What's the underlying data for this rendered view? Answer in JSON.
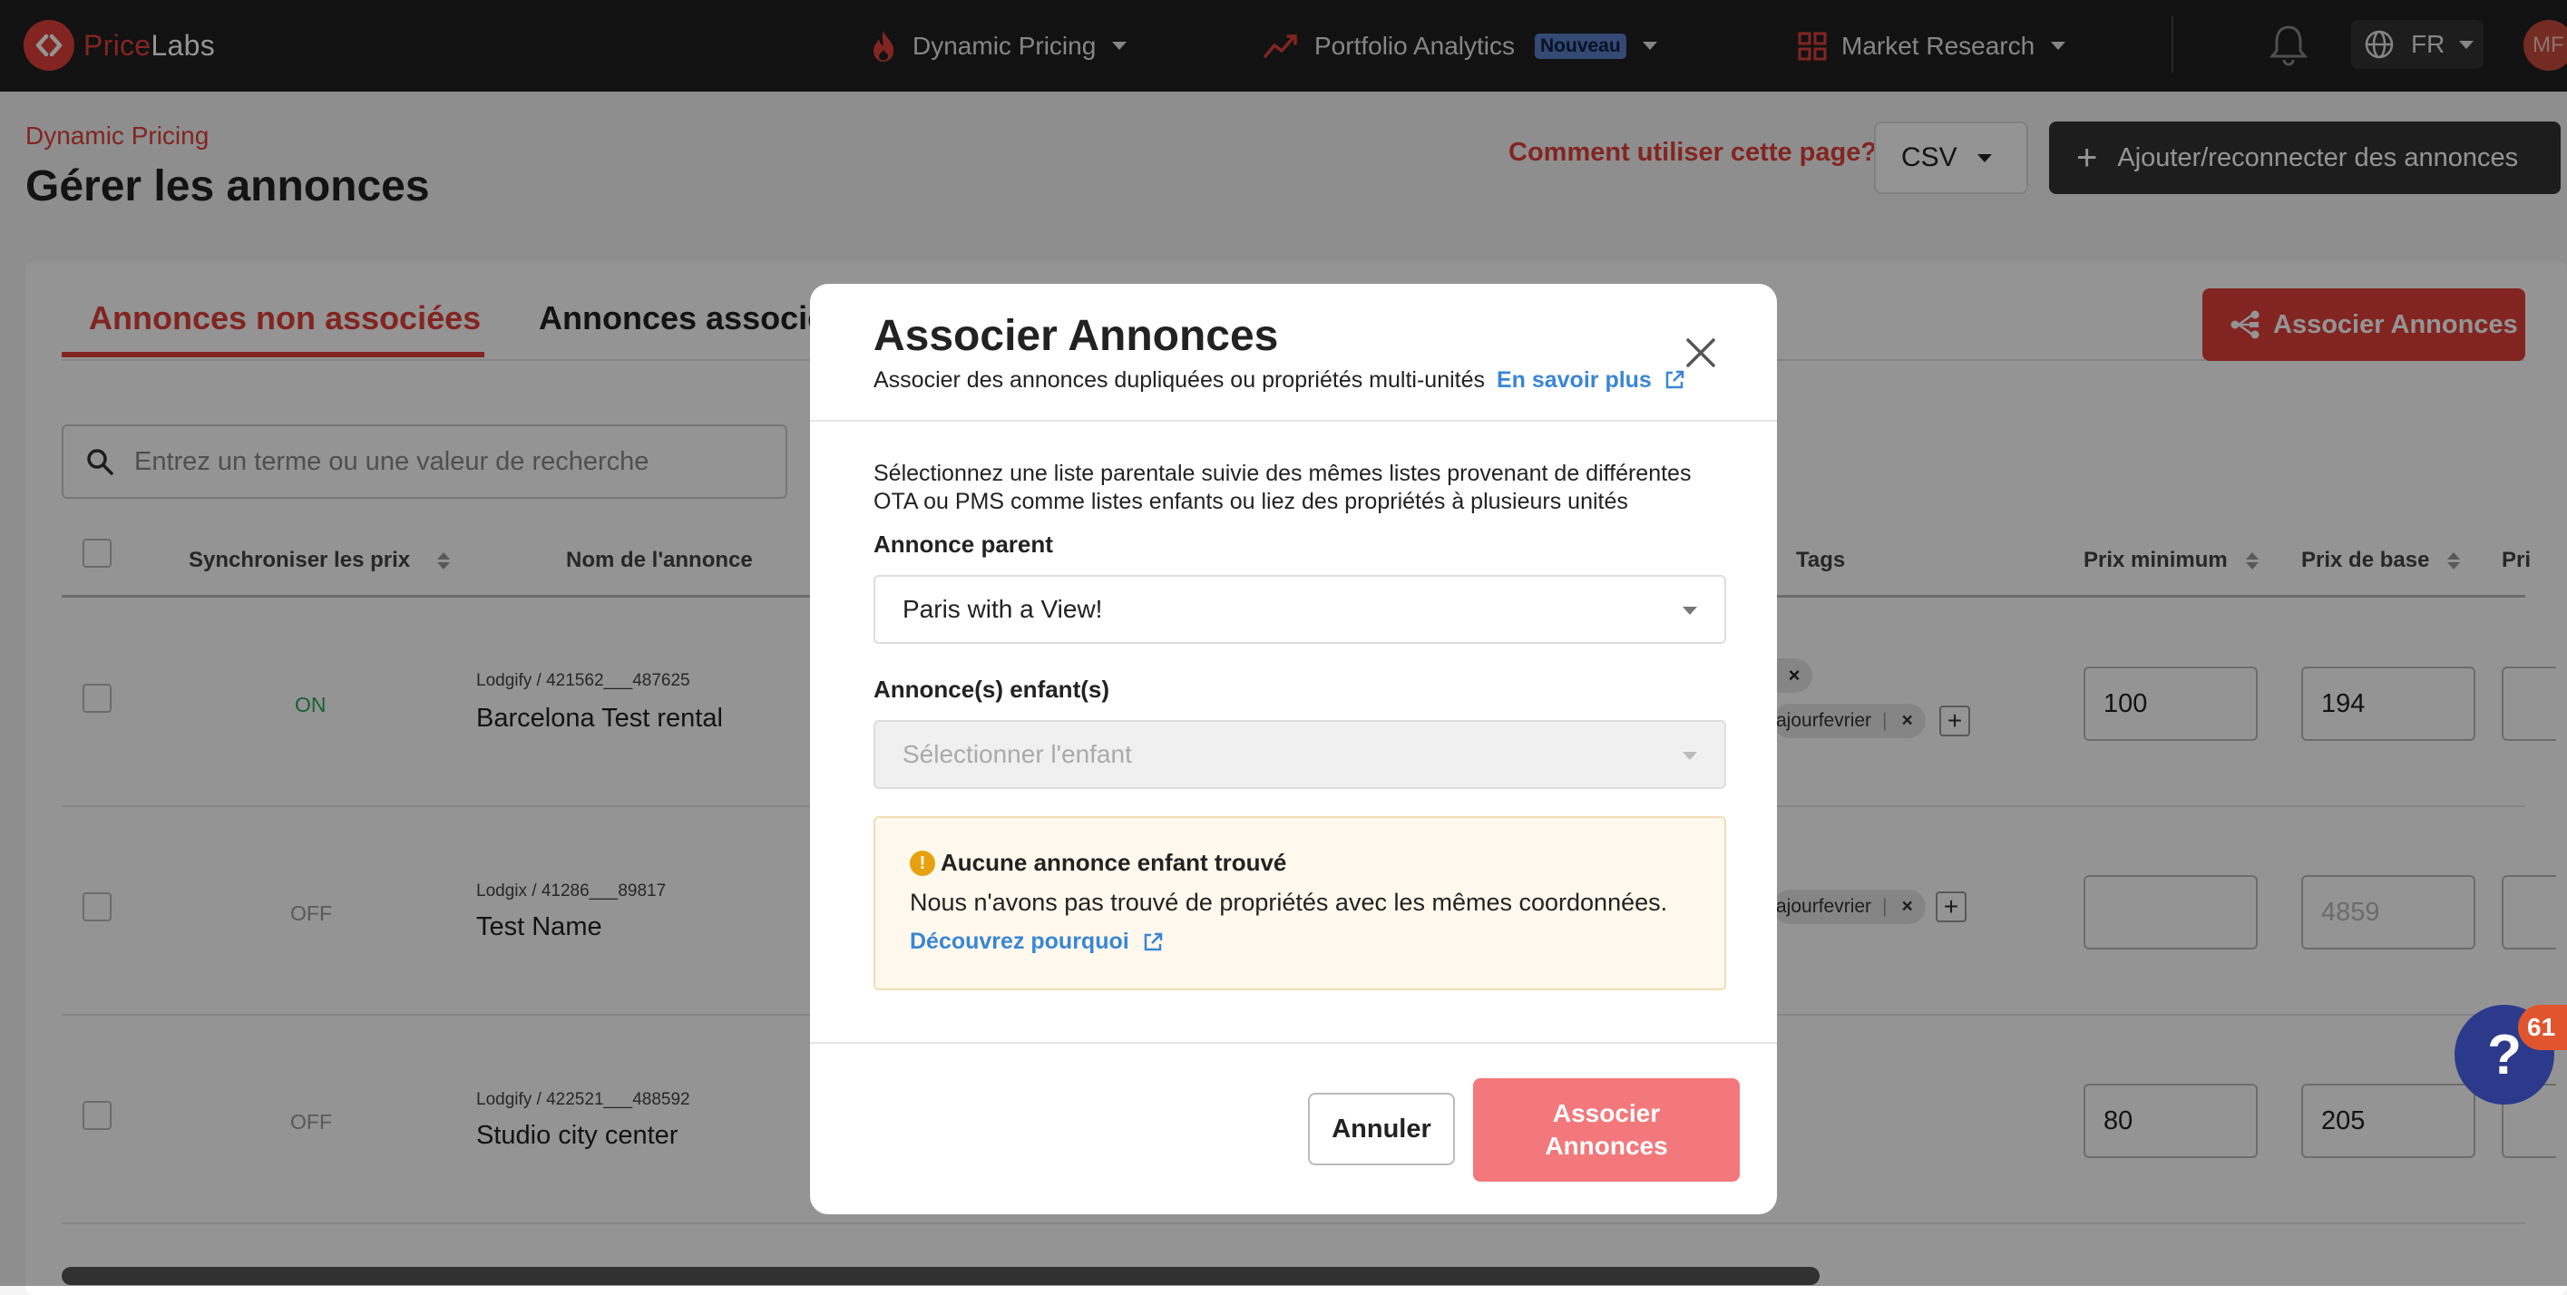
{
  "nav": {
    "logo_text_a": "Price",
    "logo_text_b": "Labs",
    "menus": [
      {
        "label": "Dynamic Pricing",
        "icon": "flame-icon"
      },
      {
        "label": "Portfolio Analytics",
        "badge": "Nouveau",
        "icon": "trend-icon"
      },
      {
        "label": "Market Research",
        "icon": "grid-icon"
      }
    ],
    "language": "FR",
    "avatar_initials": "MF"
  },
  "page": {
    "breadcrumb": "Dynamic Pricing",
    "title": "Gérer les annonces",
    "help_link": "Comment utiliser cette page?",
    "csv_label": "CSV",
    "add_label": "Ajouter/reconnecter des annonces"
  },
  "tabs": {
    "unassociated": "Annonces non associées",
    "associated": "Annonces associé",
    "associate_button": "Associer Annonces"
  },
  "search": {
    "placeholder": "Entrez un terme ou une valeur de recherche"
  },
  "table": {
    "headers": {
      "sync": "Synchroniser les prix",
      "name": "Nom de l'annonce",
      "tags": "Tags",
      "min_price": "Prix minimum",
      "base_price": "Prix de base",
      "next": "Pri"
    },
    "rows": [
      {
        "sync": "ON",
        "source": "Lodgify / 421562___487625",
        "name": "Barcelona Test rental",
        "tag": "ajourfevrier",
        "min": "100",
        "base": "194"
      },
      {
        "sync": "OFF",
        "source": "Lodgix / 41286___89817",
        "name": "Test Name",
        "tag": "ajourfevrier",
        "min": "",
        "base_placeholder": "4859"
      },
      {
        "sync": "OFF",
        "source": "Lodgify / 422521___488592",
        "name": "Studio city center",
        "min": "80",
        "base": "205"
      }
    ]
  },
  "help_widget": {
    "count": "61",
    "icon": "question-icon"
  },
  "modal": {
    "title": "Associer Annonces",
    "subtitle": "Associer des annonces dupliquées ou propriétés multi-unités",
    "learn_more": "En savoir plus",
    "description": "Sélectionnez une liste parentale suivie des mêmes listes provenant de différentes OTA ou PMS comme listes enfants ou liez des propriétés à plusieurs unités",
    "parent_label": "Annonce parent",
    "parent_value": "Paris with a View!",
    "children_label": "Annonce(s) enfant(s)",
    "children_placeholder": "Sélectionner l'enfant",
    "alert_title": "Aucune annonce enfant trouvé",
    "alert_body": "Nous n'avons pas trouvé de propriétés avec les mêmes coordonnées.",
    "alert_link": "Découvrez pourquoi",
    "cancel_label": "Annuler",
    "confirm_label": "Associer Annonces"
  },
  "colors": {
    "brand": "#e0403a",
    "link": "#3a86d4",
    "on": "#2aa55e",
    "confirm": "#f2787b"
  }
}
